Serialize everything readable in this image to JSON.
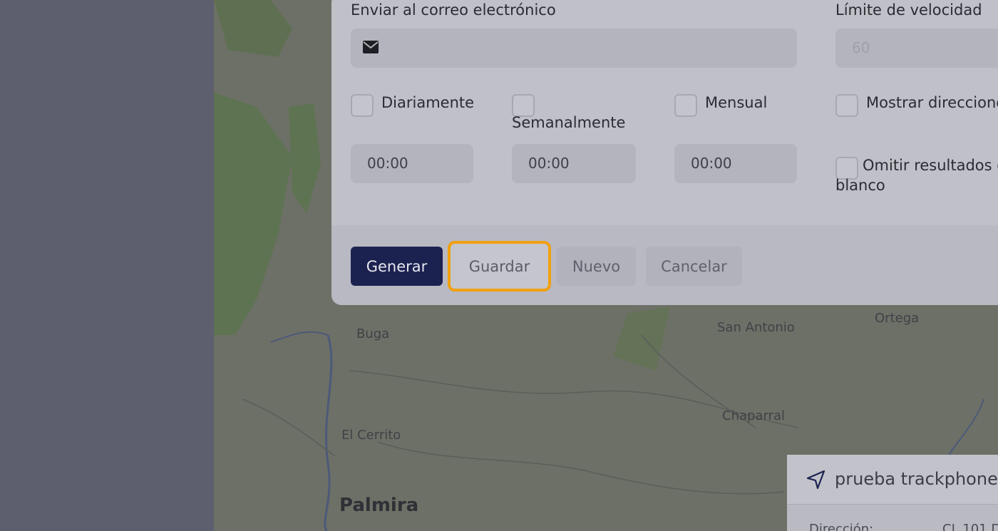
{
  "map": {
    "cities": [
      "Buga",
      "San Antonio",
      "Ortega",
      "Chaparral",
      "El Cerrito",
      "Palmira"
    ]
  },
  "form": {
    "email_label": "Enviar al correo electrónico",
    "email_value": "",
    "speed_label": "Límite de velocidad",
    "speed_placeholder": "60",
    "daily_label": "Diariamente",
    "weekly_label": "Semanalmente",
    "monthly_label": "Mensual",
    "show_addresses_label": "Mostrar direcciones",
    "omit_blank_label_1": "Omitir resultados en",
    "omit_blank_label_2": "blanco",
    "daily_time": "00:00",
    "weekly_time": "00:00",
    "monthly_time": "00:00"
  },
  "footer": {
    "generate_label": "Generar",
    "save_label": "Guardar",
    "new_label": "Nuevo",
    "cancel_label": "Cancelar"
  },
  "card": {
    "title": "prueba trackphone",
    "address_label": "Dirección:",
    "address_value": "CL 101 D"
  },
  "colors": {
    "primary": "#1c2250",
    "focus_ring": "#f0a010"
  }
}
